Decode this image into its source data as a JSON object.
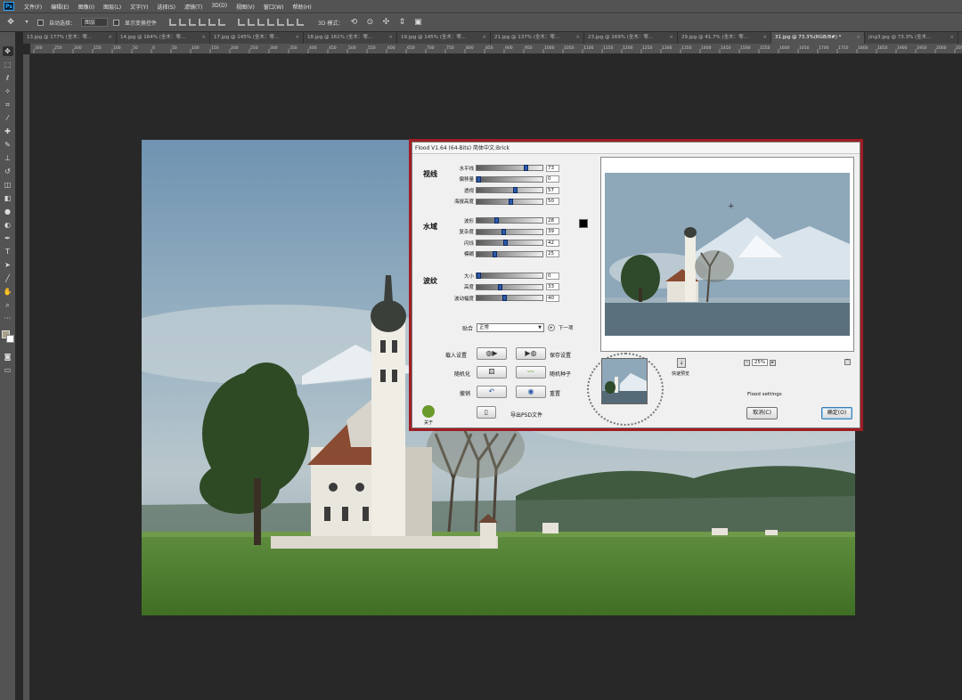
{
  "menubar": {
    "logo": "Ps",
    "items": [
      "文件(F)",
      "编辑(E)",
      "图像(I)",
      "图层(L)",
      "文字(Y)",
      "选择(S)",
      "滤镜(T)",
      "3D(D)",
      "视图(V)",
      "窗口(W)",
      "帮助(H)"
    ]
  },
  "options": {
    "auto_select_label": "自动选择：",
    "auto_select_value": "图层",
    "show_transform_label": "显示变换控件",
    "mode_label": "3D 模式："
  },
  "tabs": [
    {
      "label": "13.jpg @ 177% (全木：零…",
      "active": false
    },
    {
      "label": "14.jpg @ 164% (全木：零…",
      "active": false
    },
    {
      "label": "17.jpg @ 145% (全木：零…",
      "active": false
    },
    {
      "label": "18.jpg @ 161% (全木：零…",
      "active": false
    },
    {
      "label": "19.jpg @ 145% (全木：零…",
      "active": false
    },
    {
      "label": "21.jpg @ 137% (全木：零…",
      "active": false
    },
    {
      "label": "23.jpg @ 169% (全木：零…",
      "active": false
    },
    {
      "label": "29.jpg @ 41.7% (全木：零…",
      "active": false
    },
    {
      "label": "31.jpg @ 73.3%(RGB/8#) *",
      "active": true
    },
    {
      "label": "jing3.jpg @ 73.3% (全木…",
      "active": false
    }
  ],
  "ruler_ticks": [
    "300",
    "250",
    "200",
    "150",
    "100",
    "50",
    "0",
    "50",
    "100",
    "150",
    "200",
    "250",
    "300",
    "350",
    "400",
    "450",
    "500",
    "550",
    "600",
    "650",
    "700",
    "750",
    "800",
    "850",
    "900",
    "950",
    "1000",
    "1050",
    "1100",
    "1150",
    "1200",
    "1250",
    "1300",
    "1350",
    "1400",
    "1450",
    "1500",
    "1550",
    "1600",
    "1650",
    "1700",
    "1750",
    "1800",
    "1850",
    "1900",
    "1950",
    "2000",
    "2050"
  ],
  "dialog": {
    "title": "Flood V1.64 (64-Bits)   简体中文:Brick",
    "sections": {
      "horizon": "视线",
      "water": "水域",
      "waves": "波纹"
    },
    "sliders": {
      "horizon": [
        {
          "label": "水平线",
          "value": "73"
        },
        {
          "label": "偏移量",
          "value": "0"
        },
        {
          "label": "透视",
          "value": "57"
        },
        {
          "label": "海拔高度",
          "value": "50"
        }
      ],
      "water": [
        {
          "label": "波形",
          "value": "28"
        },
        {
          "label": "复杂度",
          "value": "39"
        },
        {
          "label": "闪烁",
          "value": "42"
        },
        {
          "label": "模糊",
          "value": "25"
        }
      ],
      "waves": [
        {
          "label": "大小",
          "value": "0"
        },
        {
          "label": "高度",
          "value": "33"
        },
        {
          "label": "波动幅度",
          "value": "40"
        }
      ]
    },
    "blend_label": "贴合",
    "blend_value": "正常",
    "next_label": "下一项",
    "load_label": "载入设置",
    "save_label": "保存设置",
    "randomize_label": "随机化",
    "random_seed_label": "随机种子",
    "undo_label": "撤销",
    "reset_label": "重置",
    "export_label": "导出PSD文件",
    "about_label": "关于",
    "fast_preview_label": "快速预览",
    "zoom_value": "25%",
    "flood_settings": "Flood settings",
    "cancel_label": "取消(C)",
    "ok_label": "确定(O)"
  }
}
